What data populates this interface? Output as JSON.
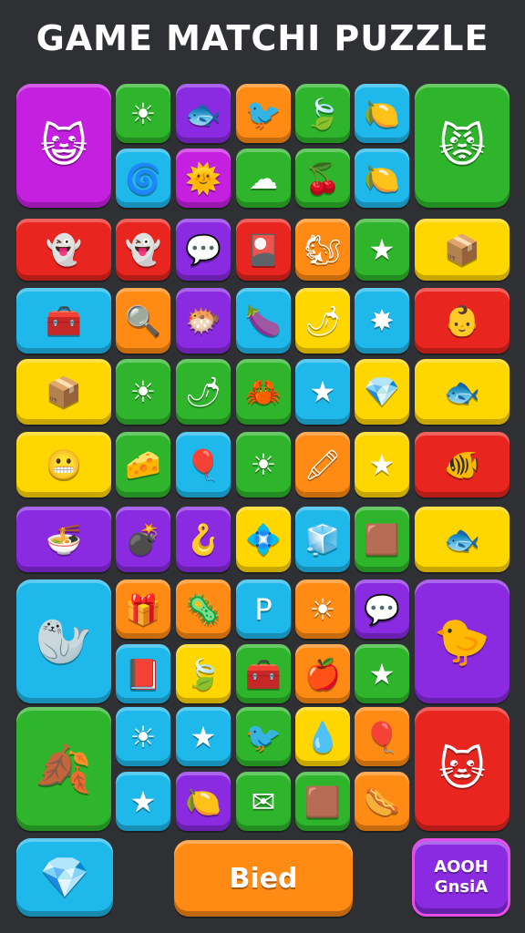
{
  "title": "GAME MATCHI PUZZLE",
  "colors": {
    "background": "#2f3034",
    "magenta": "#c51fe0",
    "green": "#2fb52b",
    "purple": "#8a2be2",
    "orange": "#ff8a14",
    "cyan": "#1fb8ea",
    "red": "#e8251f",
    "yellow": "#ffd600"
  },
  "tiles": [
    {
      "color": "#c51fe0",
      "icon": "cat-face-icon",
      "glyph": "😺",
      "big": true
    },
    {
      "color": "#2fb52b",
      "icon": "sun-icon",
      "glyph": "☀"
    },
    {
      "color": "#8a2be2",
      "icon": "fish-icon",
      "glyph": "🐟"
    },
    {
      "color": "#ff8a14",
      "icon": "bird-icon",
      "glyph": "🐦"
    },
    {
      "color": "#2fb52b",
      "icon": "leaf-icon",
      "glyph": "🍃"
    },
    {
      "color": "#1fb8ea",
      "icon": "lemon-icon",
      "glyph": "🍋"
    },
    {
      "color": "#2fb52b",
      "icon": "monster-face-icon",
      "glyph": "😾",
      "big": true
    },
    {
      "color": "#1fb8ea",
      "icon": "swirl-icon",
      "glyph": "🌀"
    },
    {
      "color": "#c51fe0",
      "icon": "sun-face-icon",
      "glyph": "🌞"
    },
    {
      "color": "#2fb52b",
      "icon": "cloud-icon",
      "glyph": "☁"
    },
    {
      "color": "#2fb52b",
      "icon": "berry-icon",
      "glyph": "🍒"
    },
    {
      "color": "#1fb8ea",
      "icon": "lemon-icon",
      "glyph": "🍋"
    },
    {
      "color": "#e8251f",
      "icon": "ghost-face-icon",
      "glyph": "👻",
      "wide": true
    },
    {
      "color": "#e8251f",
      "icon": "ghost-icon",
      "glyph": "👻"
    },
    {
      "color": "#8a2be2",
      "icon": "speech-bubble-icon",
      "glyph": "💬"
    },
    {
      "color": "#e8251f",
      "icon": "card-icon",
      "glyph": "🎴"
    },
    {
      "color": "#ff8a14",
      "icon": "squirrel-icon",
      "glyph": "🐿"
    },
    {
      "color": "#2fb52b",
      "icon": "star-icon",
      "glyph": "★"
    },
    {
      "color": "#ffd600",
      "icon": "crate-icon",
      "glyph": "📦",
      "wide": true
    },
    {
      "color": "#1fb8ea",
      "icon": "chest-icon",
      "glyph": "🧰",
      "wide": true
    },
    {
      "color": "#ff8a14",
      "icon": "magnifier-icon",
      "glyph": "🔍"
    },
    {
      "color": "#8a2be2",
      "icon": "blob-icon",
      "glyph": "🐡"
    },
    {
      "color": "#1fb8ea",
      "icon": "eggplant-icon",
      "glyph": "🍆"
    },
    {
      "color": "#ffd600",
      "icon": "pepper-icon",
      "glyph": "🌶"
    },
    {
      "color": "#1fb8ea",
      "icon": "star-burst-icon",
      "glyph": "✸"
    },
    {
      "color": "#e8251f",
      "icon": "baby-face-icon",
      "glyph": "👶",
      "wide": true
    },
    {
      "color": "#ffd600",
      "icon": "box-icon",
      "glyph": "📦",
      "wide": true
    },
    {
      "color": "#2fb52b",
      "icon": "sun-icon",
      "glyph": "☀"
    },
    {
      "color": "#2fb52b",
      "icon": "radish-icon",
      "glyph": "🌶"
    },
    {
      "color": "#2fb52b",
      "icon": "crab-icon",
      "glyph": "🦀"
    },
    {
      "color": "#1fb8ea",
      "icon": "star-icon",
      "glyph": "★"
    },
    {
      "color": "#ffd600",
      "icon": "crystal-icon",
      "glyph": "💎"
    },
    {
      "color": "#ffd600",
      "icon": "fish-icon",
      "glyph": "🐟",
      "wide": true
    },
    {
      "color": "#ffd600",
      "icon": "teeth-face-icon",
      "glyph": "😬",
      "wide": true
    },
    {
      "color": "#2fb52b",
      "icon": "cheese-icon",
      "glyph": "🧀"
    },
    {
      "color": "#1fb8ea",
      "icon": "balloon-icon",
      "glyph": "🎈"
    },
    {
      "color": "#2fb52b",
      "icon": "sun-icon",
      "glyph": "☀"
    },
    {
      "color": "#ff8a14",
      "icon": "crayon-icon",
      "glyph": "🖍"
    },
    {
      "color": "#ffd600",
      "icon": "star-icon",
      "glyph": "★"
    },
    {
      "color": "#e8251f",
      "icon": "fish-face-icon",
      "glyph": "🐠",
      "wide": true
    },
    {
      "color": "#8a2be2",
      "icon": "bowl-icon",
      "glyph": "🍜",
      "wide": true
    },
    {
      "color": "#8a2be2",
      "icon": "bomb-icon",
      "glyph": "💣"
    },
    {
      "color": "#8a2be2",
      "icon": "hook-icon",
      "glyph": "🪝"
    },
    {
      "color": "#ffd600",
      "icon": "gem-icon",
      "glyph": "💠"
    },
    {
      "color": "#1fb8ea",
      "icon": "cube-icon",
      "glyph": "🧊"
    },
    {
      "color": "#2fb52b",
      "icon": "block-icon",
      "glyph": "🟫"
    },
    {
      "color": "#ffd600",
      "icon": "fish-icon",
      "glyph": "🐟",
      "wide": true
    },
    {
      "color": "#1fb8ea",
      "icon": "seal-icon",
      "glyph": "🦭",
      "big2": true
    },
    {
      "color": "#ff8a14",
      "icon": "box-icon",
      "glyph": "🎁"
    },
    {
      "color": "#ff8a14",
      "icon": "virus-icon",
      "glyph": "🦠"
    },
    {
      "color": "#1fb8ea",
      "icon": "letter-p-icon",
      "glyph": "P"
    },
    {
      "color": "#ff8a14",
      "icon": "sun-icon",
      "glyph": "☀"
    },
    {
      "color": "#8a2be2",
      "icon": "bubble-icon",
      "glyph": "💬"
    },
    {
      "color": "#8a2be2",
      "icon": "bird-icon",
      "glyph": "🐤",
      "big2": true
    },
    {
      "color": "#1fb8ea",
      "icon": "book-icon",
      "glyph": "📕"
    },
    {
      "color": "#ffd600",
      "icon": "leaf-icon",
      "glyph": "🍃"
    },
    {
      "color": "#2fb52b",
      "icon": "chest-icon",
      "glyph": "🧰"
    },
    {
      "color": "#ff8a14",
      "icon": "apple-icon",
      "glyph": "🍎"
    },
    {
      "color": "#2fb52b",
      "icon": "star-icon",
      "glyph": "★"
    },
    {
      "color": "#2fb52b",
      "icon": "leaf-icon",
      "glyph": "🍂",
      "big2": true
    },
    {
      "color": "#1fb8ea",
      "icon": "sun-icon",
      "glyph": "☀"
    },
    {
      "color": "#1fb8ea",
      "icon": "star-icon",
      "glyph": "★"
    },
    {
      "color": "#2fb52b",
      "icon": "orange-bird-icon",
      "glyph": "🐦"
    },
    {
      "color": "#ffd600",
      "icon": "drop-icon",
      "glyph": "💧"
    },
    {
      "color": "#ff8a14",
      "icon": "balloon-icon",
      "glyph": "🎈"
    },
    {
      "color": "#e8251f",
      "icon": "cat-face-icon",
      "glyph": "🐱",
      "big2": true
    },
    {
      "color": "#1fb8ea",
      "icon": "star-icon",
      "glyph": "★"
    },
    {
      "color": "#8a2be2",
      "icon": "lemon-icon",
      "glyph": "🍋"
    },
    {
      "color": "#2fb52b",
      "icon": "envelope-icon",
      "glyph": "✉"
    },
    {
      "color": "#2fb52b",
      "icon": "cube-icon",
      "glyph": "🟫"
    },
    {
      "color": "#ff8a14",
      "icon": "sausage-icon",
      "glyph": "🌭"
    }
  ],
  "bottom_bar": {
    "left_icon": "crystal-icon",
    "left_glyph": "💎",
    "center_label": "Bied",
    "right_line1": "AOOH",
    "right_line2": "GnsiA"
  }
}
